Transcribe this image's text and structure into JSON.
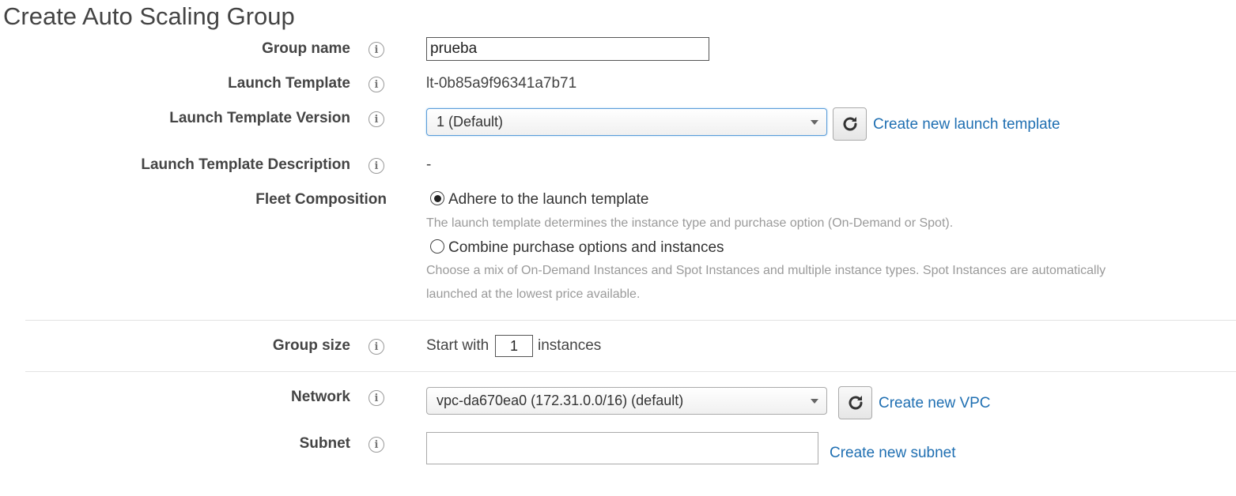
{
  "page": {
    "title": "Create Auto Scaling Group"
  },
  "form": {
    "group_name": {
      "label": "Group name",
      "value": "prueba"
    },
    "launch_template": {
      "label": "Launch Template",
      "value": "lt-0b85a9f96341a7b71"
    },
    "launch_template_version": {
      "label": "Launch Template Version",
      "selected": "1 (Default)",
      "create_link": "Create new launch template"
    },
    "launch_template_description": {
      "label": "Launch Template Description",
      "value": "-"
    },
    "fleet_composition": {
      "label": "Fleet Composition",
      "options": [
        {
          "label": "Adhere to the launch template",
          "help": "The launch template determines the instance type and purchase option (On-Demand or Spot).",
          "selected": true
        },
        {
          "label": "Combine purchase options and instances",
          "help_line1": "Choose a mix of On-Demand Instances and Spot Instances and multiple instance types. Spot Instances are automatically",
          "help_line2": "launched at the lowest price available.",
          "selected": false
        }
      ]
    },
    "group_size": {
      "label": "Group size",
      "prefix": "Start with",
      "value": "1",
      "suffix": "instances"
    },
    "network": {
      "label": "Network",
      "selected": "vpc-da670ea0 (172.31.0.0/16) (default)",
      "create_link": "Create new VPC"
    },
    "subnet": {
      "label": "Subnet",
      "value": "",
      "create_link": "Create new subnet"
    }
  },
  "icons": {
    "info": "info-icon",
    "refresh": "refresh-icon",
    "dropdown": "chevron-down-icon"
  },
  "colors": {
    "link": "#1f6fb2",
    "help_text": "#9a9a9a",
    "focus_border": "#5b9dd9"
  }
}
